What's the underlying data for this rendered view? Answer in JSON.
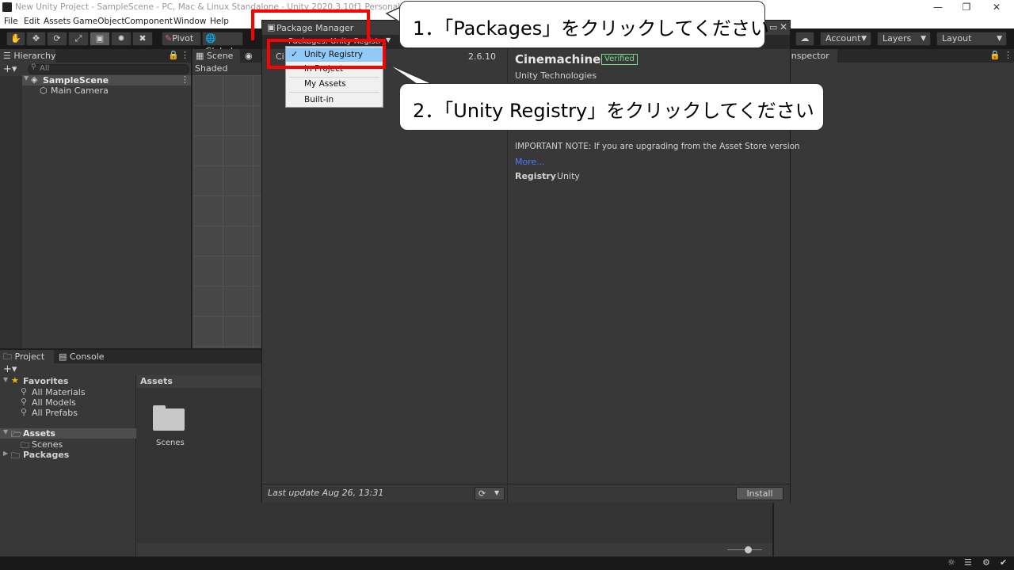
{
  "window": {
    "title": "New Unity Project - SampleScene - PC, Mac & Linux Standalone - Unity 2020.3.10f1 Personal <DX11>"
  },
  "menu": [
    "File",
    "Edit",
    "Assets",
    "GameObject",
    "Component",
    "Window",
    "Help"
  ],
  "toolbar": {
    "pivot": "Pivot",
    "global": "Global",
    "account": "Account",
    "layers": "Layers",
    "layout": "Layout"
  },
  "hierarchy": {
    "tab": "Hierarchy",
    "search_placeholder": "All",
    "scene": "SampleScene",
    "items": [
      "Main Camera"
    ]
  },
  "scene": {
    "tab": "Scene",
    "shading": "Shaded"
  },
  "inspector": {
    "tab": "Inspector"
  },
  "project": {
    "tab_project": "Project",
    "tab_console": "Console",
    "favorites": "Favorites",
    "favorite_items": [
      "All Materials",
      "All Models",
      "All Prefabs"
    ],
    "assets": "Assets",
    "asset_children": [
      "Scenes"
    ],
    "packages": "Packages",
    "breadcrumb": "Assets",
    "folder": "Scenes"
  },
  "package_manager": {
    "title": "Package Manager",
    "packages_dropdown": "Packages: Unity Registry",
    "list_item_partial": "Ci",
    "version": "2.6.10",
    "package_name": "Cinemachine",
    "badge": "Verified",
    "author": "Unity Technologies",
    "description": "IMPORTANT NOTE: If you are upgrading from the Asset Store version",
    "more_link": "More...",
    "registry_label": "Registry",
    "registry_value": "Unity",
    "last_update": "Last update Aug 26, 13:31",
    "install": "Install",
    "menu": [
      "Unity Registry",
      "In Project",
      "My Assets",
      "Built-in"
    ],
    "menu_selected": "Unity Registry"
  },
  "callouts": {
    "step1": "1．「Packages」をクリックしてください",
    "step2": "2．「Unity Registry」をクリックしてください"
  },
  "colors": {
    "highlight_red": "#ff0000",
    "menu_selected": "#91c9f7",
    "verified_green": "#7bd88f",
    "link_blue": "#4c7eff"
  }
}
